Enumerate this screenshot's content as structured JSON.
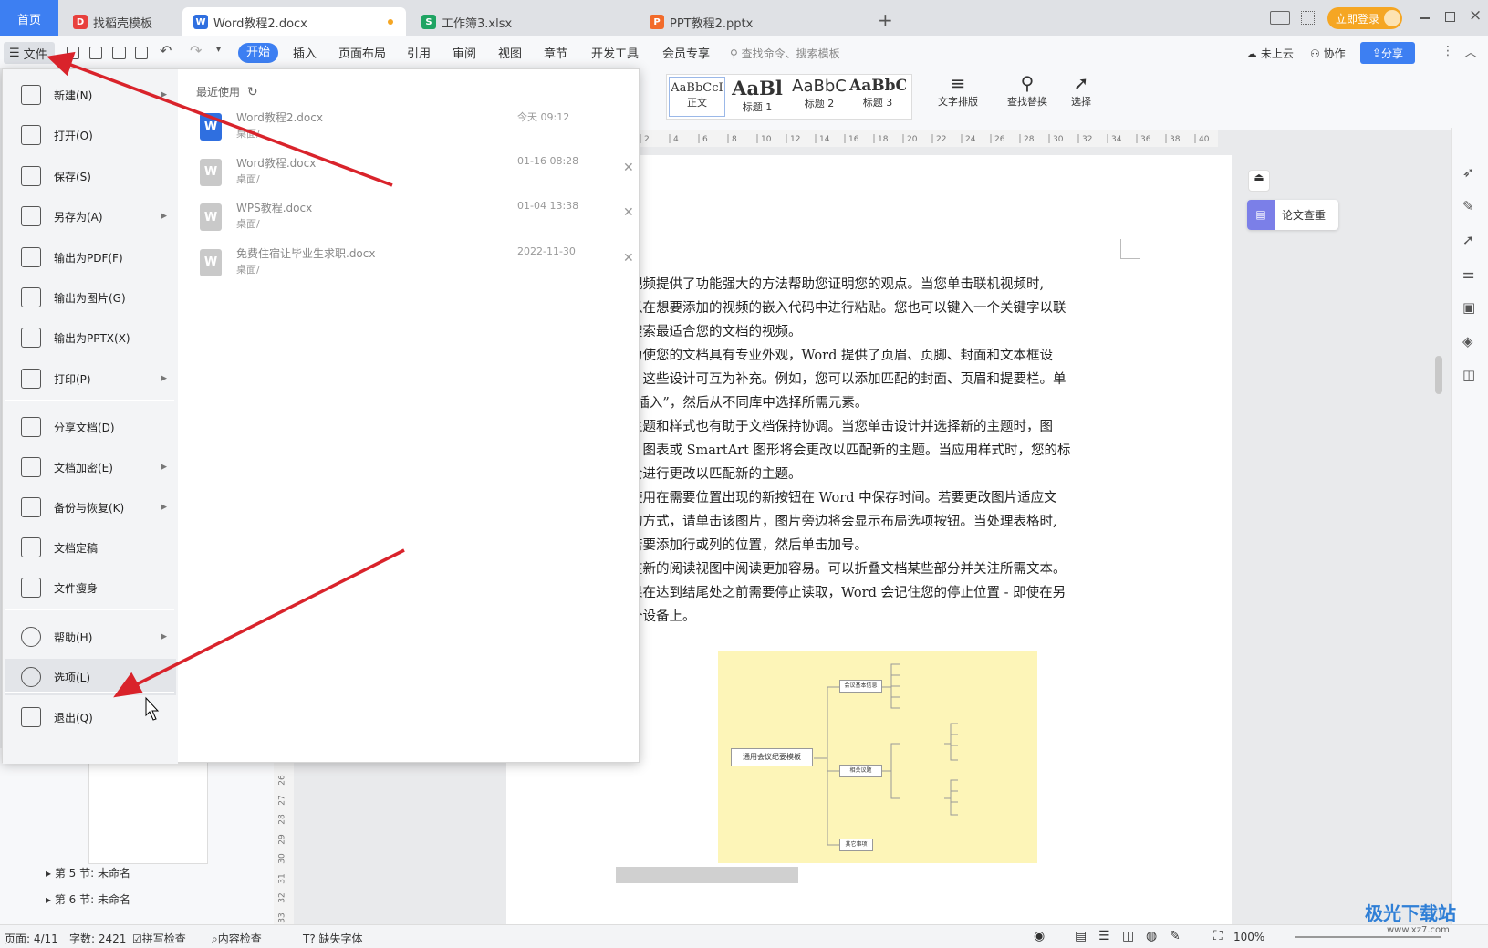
{
  "tabs": {
    "home": "首页",
    "t1": "找稻壳模板",
    "t2": "Word教程2.docx",
    "t3": "工作簿3.xlsx",
    "t4": "PPT教程2.pptx",
    "new": "+",
    "login": "立即登录"
  },
  "toolbar": {
    "file": "文件",
    "menus": [
      "开始",
      "插入",
      "页面布局",
      "引用",
      "审阅",
      "视图",
      "章节",
      "开发工具",
      "会员专享"
    ],
    "search": "查找命令、搜索模板",
    "cloud": "未上云",
    "collab": "协作",
    "share": "分享"
  },
  "ribbon": {
    "styles": [
      {
        "preview": "AaBbCcI",
        "name": "正文"
      },
      {
        "preview": "AaBl",
        "name": "标题 1"
      },
      {
        "preview": "AaBbC",
        "name": "标题 2"
      },
      {
        "preview": "AaBbC",
        "name": "标题 3"
      }
    ],
    "text_layout": "文字排版",
    "find_replace": "查找替换",
    "select": "选择"
  },
  "ruler_ticks": [
    "2",
    "4",
    "6",
    "8",
    "10",
    "12",
    "14",
    "16",
    "18",
    "20",
    "22",
    "24",
    "26",
    "28",
    "30",
    "32",
    "34",
    "36",
    "38",
    "40"
  ],
  "menu": {
    "items": [
      {
        "label": "新建(N)",
        "arrow": true
      },
      {
        "label": "打开(O)",
        "arrow": false
      },
      {
        "label": "保存(S)",
        "arrow": false
      },
      {
        "label": "另存为(A)",
        "arrow": true
      },
      {
        "label": "输出为PDF(F)",
        "arrow": false
      },
      {
        "label": "输出为图片(G)",
        "arrow": false
      },
      {
        "label": "输出为PPTX(X)",
        "arrow": false
      },
      {
        "label": "打印(P)",
        "arrow": true
      },
      {
        "label": "分享文档(D)",
        "arrow": false
      },
      {
        "label": "文档加密(E)",
        "arrow": true
      },
      {
        "label": "备份与恢复(K)",
        "arrow": true
      },
      {
        "label": "文档定稿",
        "arrow": false
      },
      {
        "label": "文件瘦身",
        "arrow": false
      },
      {
        "label": "帮助(H)",
        "arrow": true
      },
      {
        "label": "选项(L)",
        "arrow": false
      },
      {
        "label": "退出(Q)",
        "arrow": false
      }
    ],
    "recent_title": "最近使用",
    "recent": [
      {
        "name": "Word教程2.docx",
        "path": "桌面/",
        "date": "今天 09:12"
      },
      {
        "name": "Word教程.docx",
        "path": "桌面/",
        "date": "01-16 08:28"
      },
      {
        "name": "WPS教程.docx",
        "path": "桌面/",
        "date": "01-04 13:38"
      },
      {
        "name": "免费住宿让毕业生求职.docx",
        "path": "桌面/",
        "date": "2022-11-30"
      }
    ]
  },
  "document": {
    "paragraphs": [
      "视频提供了功能强大的方法帮助您证明您的观点。当您单击联机视频时,",
      "以在想要添加的视频的嵌入代码中进行粘贴。您也可以键入一个关键字以联",
      "搜索最适合您的文档的视频。",
      "  为使您的文档具有专业外观，Word 提供了页眉、页脚、封面和文本框设",
      "，这些设计可互为补充。例如，您可以添加匹配的封面、页眉和提要栏。单",
      "“插入”，然后从不同库中选择所需元素。",
      "  主题和样式也有助于文档保持协调。当您单击设计并选择新的主题时，图",
      "、图表或 SmartArt 图形将会更改以匹配新的主题。当应用样式时，您的标",
      "会进行更改以匹配新的主题。",
      "  使用在需要位置出现的新按钮在 Word 中保存时间。若要更改图片适应文",
      "的方式，请单击该图片，图片旁边将会显示布局选项按钮。当处理表格时,",
      "若要添加行或列的位置，然后单击加号。",
      "  在新的阅读视图中阅读更加容易。可以折叠文档某些部分并关注所需文本。",
      "果在达到结尾处之前需要停止读取，Word 会记住您的停止位置 - 即使在另",
      "个设备上。"
    ],
    "mindmap_root": "通用会议纪要模板",
    "mindmap_nodes": [
      "会议基本信息",
      "相关议题",
      "其它事项"
    ]
  },
  "side_panel": {
    "check": "论文查重"
  },
  "nav": {
    "sec5": "第 5 节: 未命名",
    "sec6": "第 6 节: 未命名"
  },
  "vruler_ticks": [
    "26",
    "27",
    "28",
    "29",
    "30",
    "31",
    "32",
    "33"
  ],
  "status": {
    "page": "页面: 4/11",
    "words": "字数: 2421",
    "spell": "拼写检查",
    "content": "内容检查",
    "font": "缺失字体",
    "zoom": "100%"
  },
  "watermark": {
    "text": "极光下载站",
    "url": "www.xz7.com"
  },
  "colors": {
    "accent": "#3d7ff2",
    "arrow": "#d9232b",
    "login": "#f5a623"
  }
}
